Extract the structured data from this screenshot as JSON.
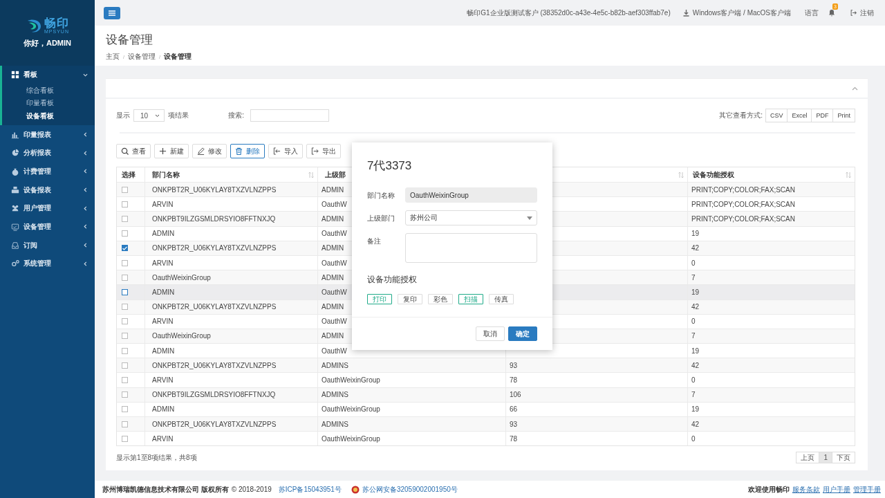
{
  "sidebar": {
    "logo": {
      "name": "畅印",
      "subtitle": "MPSYUN"
    },
    "greeting": "你好，ADMIN",
    "items": [
      {
        "label": "看板",
        "expanded": true,
        "children": [
          {
            "label": "综合看板",
            "selected": false
          },
          {
            "label": "印量看板",
            "selected": false
          },
          {
            "label": "设备看板",
            "selected": true
          }
        ]
      },
      {
        "label": "印量报表",
        "expanded": false
      },
      {
        "label": "分析报表",
        "expanded": false
      },
      {
        "label": "计费管理",
        "expanded": false
      },
      {
        "label": "设备报表",
        "expanded": false
      },
      {
        "label": "用户管理",
        "expanded": false
      },
      {
        "label": "设备管理",
        "expanded": false
      },
      {
        "label": "订阅",
        "expanded": false
      },
      {
        "label": "系统管理",
        "expanded": false
      }
    ]
  },
  "topbar": {
    "customer": "畅印G1企业版测试客户 (38352d0c-a43e-4e5c-b82b-aef303ffab7e)",
    "download": "Windows客户端 / MacOS客户端",
    "language": "语言",
    "notification_count": "3",
    "logout": "注销"
  },
  "page": {
    "title": "设备管理",
    "breadcrumb": [
      "主页",
      "设备管理",
      "设备管理"
    ],
    "breadcrumb_separator": "/"
  },
  "controls": {
    "show_label": "显示",
    "page_size": "10",
    "page_size_suffix": "项结果",
    "search_label": "搜索:",
    "export_label": "其它查看方式:",
    "export_buttons": [
      "CSV",
      "Excel",
      "PDF",
      "Print"
    ]
  },
  "toolbar": [
    {
      "label": "查看",
      "active": false
    },
    {
      "label": "新建",
      "active": false
    },
    {
      "label": "修改",
      "active": false
    },
    {
      "label": "删除",
      "active": true
    },
    {
      "label": "导入",
      "active": false
    },
    {
      "label": "导出",
      "active": false
    }
  ],
  "table": {
    "columns": [
      {
        "label": "选择",
        "sortable": false
      },
      {
        "label": "部门名称",
        "sortable": true
      },
      {
        "label": "上级部"
      },
      {
        "sortable": true
      },
      {
        "label": "设备功能授权",
        "sortable": true
      }
    ],
    "rows": [
      {
        "checked": false,
        "highlighted": false,
        "name": "ONKPBT2R_U06KYLAY8TXZVLNZPPS",
        "parent": "ADMIN",
        "auth": "PRINT;COPY;COLOR;FAX;SCAN"
      },
      {
        "checked": false,
        "highlighted": false,
        "name": "ARVIN",
        "parent": "OauthW",
        "auth": "PRINT;COPY;COLOR;FAX;SCAN"
      },
      {
        "checked": false,
        "highlighted": false,
        "name": "ONKPBT9ILZGSMLDRSYIO8FFTNXJQ",
        "parent": "ADMIN",
        "auth": "PRINT;COPY;COLOR;FAX;SCAN"
      },
      {
        "checked": false,
        "highlighted": false,
        "name": "ADMIN",
        "parent": "OauthW",
        "auth": "19"
      },
      {
        "checked": true,
        "highlighted": false,
        "name": "ONKPBT2R_U06KYLAY8TXZVLNZPPS",
        "parent": "ADMIN",
        "auth": "42"
      },
      {
        "checked": false,
        "highlighted": false,
        "name": "ARVIN",
        "parent": "OauthW",
        "auth": "0"
      },
      {
        "checked": false,
        "highlighted": false,
        "name": "OauthWeixinGroup",
        "parent": "ADMIN",
        "auth": "7"
      },
      {
        "checked": false,
        "highlighted": true,
        "name": "ADMIN",
        "parent": "OauthW",
        "auth": "19"
      },
      {
        "checked": false,
        "highlighted": false,
        "name": "ONKPBT2R_U06KYLAY8TXZVLNZPPS",
        "parent": "ADMIN",
        "auth": "42"
      },
      {
        "checked": false,
        "highlighted": false,
        "name": "ARVIN",
        "parent": "OauthW",
        "auth": "0"
      },
      {
        "checked": false,
        "highlighted": false,
        "name": "OauthWeixinGroup",
        "parent": "ADMIN",
        "auth": "7"
      },
      {
        "checked": false,
        "highlighted": false,
        "name": "ADMIN",
        "parent": "OauthW",
        "auth": "19"
      },
      {
        "checked": false,
        "highlighted": false,
        "name": "ONKPBT2R_U06KYLAY8TXZVLNZPPS",
        "parent": "ADMINS",
        "column_4": "93",
        "auth": "42"
      },
      {
        "checked": false,
        "highlighted": false,
        "name": "ARVIN",
        "parent": "OauthWeixinGroup",
        "column_4": "78",
        "auth": "0"
      },
      {
        "checked": false,
        "highlighted": false,
        "name": "ONKPBT9ILZGSMLDRSYIO8FFTNXJQ",
        "parent": "ADMINS",
        "column_4": "106",
        "auth": "7"
      },
      {
        "checked": false,
        "highlighted": false,
        "name": "ADMIN",
        "parent": "OauthWeixinGroup",
        "column_4": "66",
        "auth": "19"
      },
      {
        "checked": false,
        "highlighted": false,
        "name": "ONKPBT2R_U06KYLAY8TXZVLNZPPS",
        "parent": "ADMINS",
        "column_4": "93",
        "auth": "42"
      },
      {
        "checked": false,
        "highlighted": false,
        "name": "ARVIN",
        "parent": "OauthWeixinGroup",
        "column_4": "78",
        "auth": "0"
      }
    ],
    "info": "显示第1至8项结果，共8项"
  },
  "pagination": {
    "prev": "上页",
    "pages": [
      {
        "label": "1",
        "selected": true
      }
    ],
    "next": "下页"
  },
  "modal": {
    "title": "7代3373",
    "fields": [
      {
        "label": "部门名称",
        "kind": "readonly",
        "value": "OauthWeixinGroup"
      },
      {
        "label": "上级部门",
        "kind": "select",
        "value": "苏州公司"
      },
      {
        "label": "备注",
        "kind": "textarea"
      }
    ],
    "section_title": "设备功能授权",
    "permissions": [
      {
        "label": "打印",
        "on": true
      },
      {
        "label": "复印",
        "on": false
      },
      {
        "label": "彩色",
        "on": false
      },
      {
        "label": "扫描",
        "on": true
      },
      {
        "label": "传真",
        "on": false
      }
    ],
    "buttons": [
      {
        "label": "取消",
        "kind": "default"
      },
      {
        "label": "确定",
        "kind": "primary"
      }
    ]
  },
  "footer": {
    "company": "苏州博瑞凯德信息技术有限公司 版权所有",
    "copyright": "© 2018-2019",
    "icp": "苏ICP备15043951号",
    "police": "苏公网安备32059002001950号",
    "welcome": "欢迎使用畅印",
    "links": [
      "服务条款",
      "用户手册",
      "管理手册"
    ]
  }
}
